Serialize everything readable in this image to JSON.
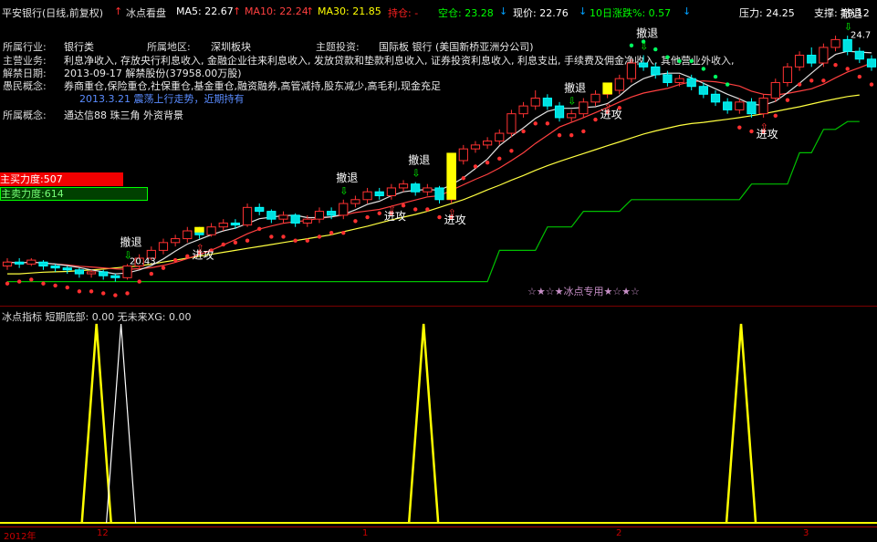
{
  "header": {
    "stock": "平安银行(日线,前复权)",
    "indicator": "冰点看盘",
    "ma5": "MA5: 22.67",
    "ma10": "MA10: 22.24",
    "ma30": "MA30: 21.85",
    "hold": "持仓: -",
    "empty": "空仓: 23.28",
    "price": "现价: 22.76",
    "change": "10日涨跌%: 0.57",
    "pressure": "压力: 24.25",
    "support": "支撑: 19.12",
    "colors": {
      "ma5": "#ffffff",
      "ma10": "#ff4040",
      "ma30": "#ffff00",
      "hold": "#ff2020",
      "empty": "#00ff00",
      "price": "#ffffff",
      "change": "#00ff00"
    }
  },
  "info": {
    "industry_label": "所属行业:",
    "industry": "银行类",
    "region_label": "所属地区:",
    "region": "深圳板块",
    "theme_label": "主题投资:",
    "theme": "国际板  银行 (美国新桥亚洲分公司)",
    "business_label": "主营业务:",
    "business": "利息净收入, 存放央行利息收入, 金融企业往来利息收入, 发放贷款和垫款利息收入, 证券投资利息收入, 利息支出, 手续费及佣金净收入, 其他营业外收入,",
    "unlock_label": "解禁日期:",
    "unlock": "2013-09-17 解禁股份(37958.00万股)",
    "concept_label": "愚民概念:",
    "concept": "券商重仓,保险重仓,社保重仓,基金重仓,融资融券,高管减持,股东减少,高毛利,现金充足",
    "note": "2013.3.21 震荡上行走势，近期持有",
    "belong_label": "所属概念:",
    "belong": "通达信88 珠三角 外资背景"
  },
  "forces": {
    "buy": "主买力度:507",
    "sell": "主卖力度:614"
  },
  "signals": {
    "retreat": "撤退",
    "attack": "进攻"
  },
  "star_label": "☆★☆★冰点专用★☆★☆",
  "indicator_panel": {
    "title": "冰点指标  短期底部: 0.00  无未来XG: 0.00"
  },
  "axis_labels": [
    "2012年",
    "12",
    "1",
    "2",
    "3"
  ],
  "price_marks": {
    "low": "20.43",
    "high": "24.7"
  },
  "chart_data": {
    "type": "candlestick",
    "candles": [
      {
        "o": 18.9,
        "c": 19.0,
        "h": 19.1,
        "l": 18.8
      },
      {
        "o": 19.0,
        "c": 18.95,
        "h": 19.1,
        "l": 18.85
      },
      {
        "o": 18.95,
        "c": 19.05,
        "h": 19.1,
        "l": 18.9
      },
      {
        "o": 19.0,
        "c": 18.9,
        "h": 19.05,
        "l": 18.8
      },
      {
        "o": 18.9,
        "c": 18.85,
        "h": 18.95,
        "l": 18.75
      },
      {
        "o": 18.85,
        "c": 18.8,
        "h": 18.9,
        "l": 18.7
      },
      {
        "o": 18.8,
        "c": 18.7,
        "h": 18.85,
        "l": 18.6
      },
      {
        "o": 18.7,
        "c": 18.75,
        "h": 18.8,
        "l": 18.6
      },
      {
        "o": 18.75,
        "c": 18.65,
        "h": 18.8,
        "l": 18.55
      },
      {
        "o": 18.65,
        "c": 18.6,
        "h": 18.7,
        "l": 18.5
      },
      {
        "o": 18.6,
        "c": 18.9,
        "h": 18.95,
        "l": 18.55
      },
      {
        "o": 18.9,
        "c": 19.1,
        "h": 19.2,
        "l": 18.85
      },
      {
        "o": 19.1,
        "c": 19.3,
        "h": 19.4,
        "l": 19.05
      },
      {
        "o": 19.3,
        "c": 19.5,
        "h": 19.6,
        "l": 19.2
      },
      {
        "o": 19.5,
        "c": 19.6,
        "h": 19.7,
        "l": 19.4
      },
      {
        "o": 19.6,
        "c": 19.8,
        "h": 19.9,
        "l": 19.5
      },
      {
        "o": 19.8,
        "c": 19.7,
        "h": 19.9,
        "l": 19.6
      },
      {
        "o": 19.7,
        "c": 19.9,
        "h": 20.0,
        "l": 19.65
      },
      {
        "o": 19.9,
        "c": 20.0,
        "h": 20.1,
        "l": 19.8
      },
      {
        "o": 20.0,
        "c": 19.95,
        "h": 20.1,
        "l": 19.85
      },
      {
        "o": 19.95,
        "c": 20.4,
        "h": 20.5,
        "l": 19.9
      },
      {
        "o": 20.4,
        "c": 20.3,
        "h": 20.5,
        "l": 20.2
      },
      {
        "o": 20.3,
        "c": 20.1,
        "h": 20.35,
        "l": 20.0
      },
      {
        "o": 20.1,
        "c": 20.2,
        "h": 20.3,
        "l": 20.0
      },
      {
        "o": 20.2,
        "c": 20.0,
        "h": 20.25,
        "l": 19.9
      },
      {
        "o": 20.0,
        "c": 20.1,
        "h": 20.2,
        "l": 19.9
      },
      {
        "o": 20.1,
        "c": 20.3,
        "h": 20.4,
        "l": 20.0
      },
      {
        "o": 20.3,
        "c": 20.2,
        "h": 20.4,
        "l": 20.1
      },
      {
        "o": 20.2,
        "c": 20.5,
        "h": 20.6,
        "l": 20.1
      },
      {
        "o": 20.5,
        "c": 20.6,
        "h": 20.7,
        "l": 20.4
      },
      {
        "o": 20.6,
        "c": 20.8,
        "h": 20.9,
        "l": 20.5
      },
      {
        "o": 20.8,
        "c": 20.7,
        "h": 20.9,
        "l": 20.6
      },
      {
        "o": 20.7,
        "c": 20.9,
        "h": 21.0,
        "l": 20.6
      },
      {
        "o": 20.9,
        "c": 21.0,
        "h": 21.1,
        "l": 20.8
      },
      {
        "o": 21.0,
        "c": 20.8,
        "h": 21.05,
        "l": 20.7
      },
      {
        "o": 20.8,
        "c": 20.9,
        "h": 21.0,
        "l": 20.7
      },
      {
        "o": 20.9,
        "c": 20.6,
        "h": 20.95,
        "l": 20.5
      },
      {
        "o": 20.6,
        "c": 21.6,
        "h": 21.7,
        "l": 20.5
      },
      {
        "o": 21.6,
        "c": 21.9,
        "h": 22.0,
        "l": 21.5
      },
      {
        "o": 21.9,
        "c": 22.0,
        "h": 22.1,
        "l": 21.8
      },
      {
        "o": 22.0,
        "c": 22.1,
        "h": 22.2,
        "l": 21.9
      },
      {
        "o": 22.1,
        "c": 22.3,
        "h": 22.4,
        "l": 22.0
      },
      {
        "o": 22.3,
        "c": 22.8,
        "h": 22.9,
        "l": 22.2
      },
      {
        "o": 22.8,
        "c": 23.0,
        "h": 23.1,
        "l": 22.7
      },
      {
        "o": 23.0,
        "c": 23.2,
        "h": 23.4,
        "l": 22.9
      },
      {
        "o": 23.2,
        "c": 23.0,
        "h": 23.3,
        "l": 22.9
      },
      {
        "o": 23.0,
        "c": 22.7,
        "h": 23.1,
        "l": 22.6
      },
      {
        "o": 22.7,
        "c": 22.8,
        "h": 22.9,
        "l": 22.6
      },
      {
        "o": 22.8,
        "c": 23.1,
        "h": 23.2,
        "l": 22.7
      },
      {
        "o": 23.1,
        "c": 23.3,
        "h": 23.4,
        "l": 23.0
      },
      {
        "o": 23.3,
        "c": 23.4,
        "h": 23.5,
        "l": 23.2
      },
      {
        "o": 23.4,
        "c": 23.7,
        "h": 23.8,
        "l": 23.3
      },
      {
        "o": 23.7,
        "c": 24.1,
        "h": 24.2,
        "l": 23.6
      },
      {
        "o": 24.1,
        "c": 24.0,
        "h": 24.3,
        "l": 23.9
      },
      {
        "o": 24.0,
        "c": 23.8,
        "h": 24.1,
        "l": 23.7
      },
      {
        "o": 23.8,
        "c": 23.6,
        "h": 23.9,
        "l": 23.5
      },
      {
        "o": 23.6,
        "c": 23.7,
        "h": 23.8,
        "l": 23.5
      },
      {
        "o": 23.7,
        "c": 23.5,
        "h": 23.8,
        "l": 23.4
      },
      {
        "o": 23.5,
        "c": 23.3,
        "h": 23.6,
        "l": 23.2
      },
      {
        "o": 23.3,
        "c": 23.1,
        "h": 23.4,
        "l": 23.0
      },
      {
        "o": 23.1,
        "c": 22.9,
        "h": 23.2,
        "l": 22.8
      },
      {
        "o": 22.9,
        "c": 23.1,
        "h": 23.2,
        "l": 22.8
      },
      {
        "o": 23.1,
        "c": 22.8,
        "h": 23.2,
        "l": 22.7
      },
      {
        "o": 22.8,
        "c": 23.2,
        "h": 23.3,
        "l": 22.7
      },
      {
        "o": 23.2,
        "c": 23.6,
        "h": 23.7,
        "l": 23.1
      },
      {
        "o": 23.6,
        "c": 24.0,
        "h": 24.1,
        "l": 23.5
      },
      {
        "o": 24.0,
        "c": 24.3,
        "h": 24.4,
        "l": 23.9
      },
      {
        "o": 24.3,
        "c": 24.1,
        "h": 24.5,
        "l": 24.0
      },
      {
        "o": 24.1,
        "c": 24.5,
        "h": 24.6,
        "l": 24.0
      },
      {
        "o": 24.5,
        "c": 24.7,
        "h": 24.8,
        "l": 24.4
      },
      {
        "o": 24.7,
        "c": 24.4,
        "h": 24.8,
        "l": 24.3
      },
      {
        "o": 24.4,
        "c": 24.2,
        "h": 24.5,
        "l": 24.1
      },
      {
        "o": 24.2,
        "c": 24.0,
        "h": 24.3,
        "l": 23.9
      }
    ],
    "ma_yellow": [
      18.7,
      18.7,
      18.72,
      18.74,
      18.75,
      18.76,
      18.78,
      18.8,
      18.82,
      18.85,
      18.88,
      18.9,
      18.95,
      19.0,
      19.05,
      19.1,
      19.15,
      19.2,
      19.25,
      19.3,
      19.35,
      19.4,
      19.45,
      19.5,
      19.55,
      19.6,
      19.65,
      19.7,
      19.78,
      19.85,
      19.92,
      20.0,
      20.08,
      20.15,
      20.22,
      20.3,
      20.4,
      20.5,
      20.6,
      20.72,
      20.85,
      20.97,
      21.1,
      21.22,
      21.35,
      21.47,
      21.58,
      21.68,
      21.78,
      21.88,
      21.98,
      22.08,
      22.18,
      22.28,
      22.36,
      22.43,
      22.5,
      22.55,
      22.58,
      22.62,
      22.66,
      22.7,
      22.75,
      22.8,
      22.86,
      22.92,
      22.98,
      23.05,
      23.12,
      23.18,
      23.24,
      23.28
    ],
    "support_line": [
      18.5,
      18.5,
      18.5,
      18.5,
      18.5,
      18.5,
      18.5,
      18.5,
      18.5,
      18.5,
      18.5,
      18.5,
      18.5,
      18.5,
      18.5,
      18.5,
      18.5,
      18.5,
      18.5,
      18.5,
      18.5,
      18.5,
      18.5,
      18.5,
      18.5,
      18.5,
      18.5,
      18.5,
      18.5,
      18.5,
      18.5,
      18.5,
      18.5,
      18.5,
      18.5,
      18.5,
      18.5,
      18.5,
      18.5,
      18.5,
      18.5,
      19.3,
      19.3,
      19.3,
      19.3,
      19.9,
      19.9,
      19.9,
      20.3,
      20.3,
      20.3,
      20.3,
      20.6,
      20.6,
      20.6,
      20.6,
      20.6,
      20.6,
      20.6,
      20.6,
      20.6,
      20.6,
      21.0,
      21.0,
      21.0,
      21.0,
      21.8,
      21.8,
      22.4,
      22.4,
      22.6,
      22.6
    ],
    "signal_spikes": [
      {
        "x": 0.11,
        "color": "#ffff00"
      },
      {
        "x": 0.138,
        "color": "#ffffff"
      },
      {
        "x": 0.483,
        "color": "#ffff00"
      },
      {
        "x": 0.845,
        "color": "#ffff00"
      }
    ],
    "ylim": [
      18.0,
      25.2
    ]
  }
}
